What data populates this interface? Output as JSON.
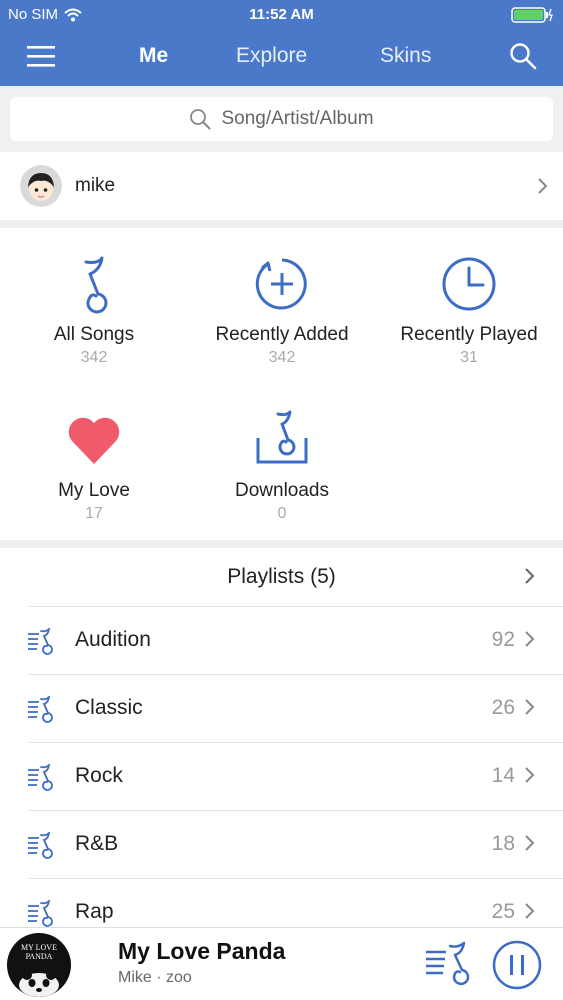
{
  "status_bar": {
    "carrier": "No SIM",
    "time": "11:52 AM"
  },
  "nav": {
    "tabs": [
      "Me",
      "Explore",
      "Skins"
    ],
    "active_tab": "Me"
  },
  "search": {
    "placeholder": "Song/Artist/Album"
  },
  "profile": {
    "username": "mike"
  },
  "library": [
    {
      "label": "All Songs",
      "count": "342",
      "icon": "music-note-icon"
    },
    {
      "label": "Recently Added",
      "count": "342",
      "icon": "add-circle-icon"
    },
    {
      "label": "Recently Played",
      "count": "31",
      "icon": "clock-icon"
    },
    {
      "label": "My Love",
      "count": "17",
      "icon": "heart-icon"
    },
    {
      "label": "Downloads",
      "count": "0",
      "icon": "download-tray-icon"
    }
  ],
  "playlists": {
    "title": "Playlists (5)",
    "items": [
      {
        "name": "Audition",
        "count": "92"
      },
      {
        "name": "Classic",
        "count": "26"
      },
      {
        "name": "Rock",
        "count": "14"
      },
      {
        "name": "R&B",
        "count": "18"
      },
      {
        "name": "Rap",
        "count": "25"
      }
    ]
  },
  "now_playing": {
    "cover_text": "MY LOVE PANDA",
    "song": "My Love Panda",
    "artist": "Mike · zoo"
  },
  "colors": {
    "accent": "#4a79c9",
    "icon_blue": "#3d6cc4",
    "heart": "#ef5b6a"
  }
}
